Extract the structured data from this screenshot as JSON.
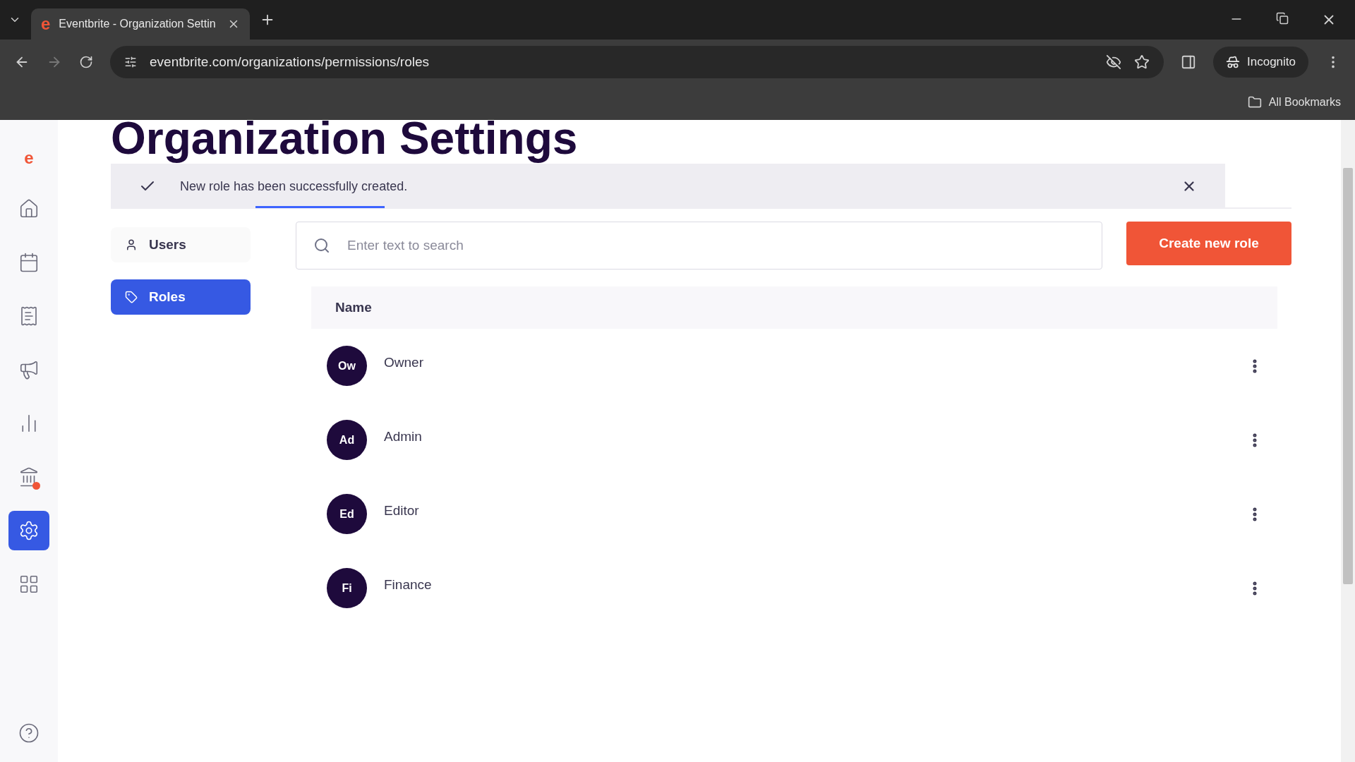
{
  "browser": {
    "favicon": "e",
    "tab_title": "Eventbrite - Organization Settin",
    "url": "eventbrite.com/organizations/permissions/roles",
    "profile": "Incognito",
    "bookmarks": "All Bookmarks"
  },
  "rail": {
    "logo": "e",
    "items": [
      {
        "kind": "home",
        "selected": false,
        "badge": false
      },
      {
        "kind": "calendar",
        "selected": false,
        "badge": false
      },
      {
        "kind": "orders",
        "selected": false,
        "badge": false
      },
      {
        "kind": "marketing",
        "selected": false,
        "badge": false
      },
      {
        "kind": "reports",
        "selected": false,
        "badge": false
      },
      {
        "kind": "finance",
        "selected": false,
        "badge": true
      },
      {
        "kind": "settings",
        "selected": true,
        "badge": false
      },
      {
        "kind": "apps",
        "selected": false,
        "badge": false
      }
    ]
  },
  "page": {
    "title": "Organization Settings"
  },
  "toast": {
    "message": "New role has been successfully created."
  },
  "side_menu": [
    {
      "kind": "user",
      "label": "Users",
      "selected": false
    },
    {
      "kind": "tag",
      "label": "Roles",
      "selected": true
    }
  ],
  "search": {
    "placeholder": "Enter text to search"
  },
  "create_button": "Create new role",
  "table": {
    "columns": [
      "Name"
    ],
    "rows": [
      {
        "initials": "Ow",
        "name": "Owner"
      },
      {
        "initials": "Ad",
        "name": "Admin"
      },
      {
        "initials": "Ed",
        "name": "Editor"
      },
      {
        "initials": "Fi",
        "name": "Finance"
      }
    ]
  }
}
